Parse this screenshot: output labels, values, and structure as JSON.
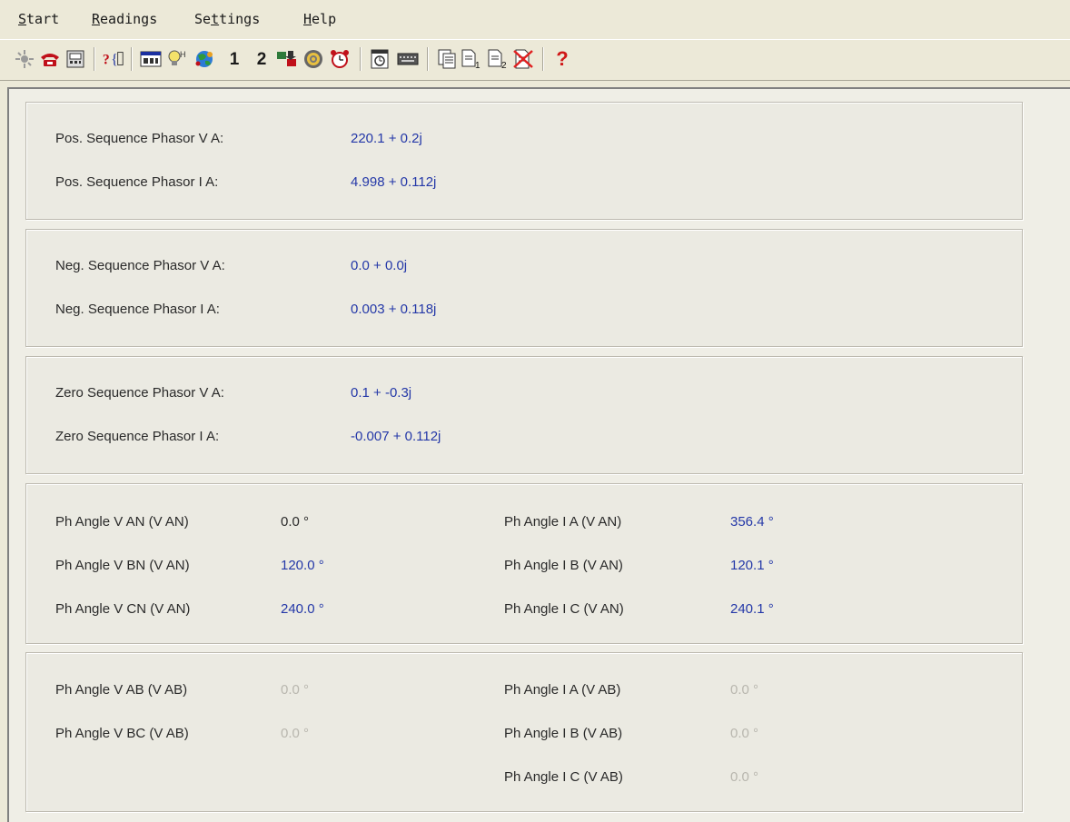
{
  "menu": {
    "start": {
      "first": "S",
      "rest": "tart"
    },
    "readings": {
      "first": "R",
      "rest": "eadings"
    },
    "settings": {
      "pre": "Se",
      "u": "t",
      "post": "tings"
    },
    "help": {
      "first": "H",
      "rest": "elp"
    }
  },
  "toolbar": {
    "icons": [
      "connect-icon",
      "phone-icon",
      "device-icon",
      "query-icon",
      "display-icon",
      "lightbulb-icon",
      "globe-icon",
      "number-1-icon",
      "number-2-icon",
      "transfer-icon",
      "target-icon",
      "alarm-icon",
      "timer-icon",
      "keyboard-icon",
      "copy-icon",
      "doc1-icon",
      "doc2-icon",
      "delete-icon",
      "help-icon"
    ],
    "label_1": "1",
    "label_2": "2",
    "label_help": "?"
  },
  "pos_sequence": {
    "v_label": "Pos. Sequence Phasor V A:",
    "v_value": "220.1 + 0.2j",
    "i_label": "Pos. Sequence Phasor I A:",
    "i_value": "4.998 + 0.112j"
  },
  "neg_sequence": {
    "v_label": "Neg. Sequence Phasor V A:",
    "v_value": "0.0 + 0.0j",
    "i_label": "Neg. Sequence Phasor I A:",
    "i_value": "0.003 + 0.118j"
  },
  "zero_sequence": {
    "v_label": "Zero Sequence Phasor V A:",
    "v_value": "0.1 + -0.3j",
    "i_label": "Zero Sequence Phasor I A:",
    "i_value": "-0.007 + 0.112j"
  },
  "angles_van": {
    "rows": [
      {
        "v_label": "Ph Angle V AN (V AN)",
        "v_value": "0.0 °",
        "i_label": "Ph Angle I A (V AN)",
        "i_value": "356.4 °"
      },
      {
        "v_label": "Ph Angle V BN (V AN)",
        "v_value": "120.0 °",
        "i_label": "Ph Angle I B (V AN)",
        "i_value": "120.1 °"
      },
      {
        "v_label": "Ph Angle V CN (V AN)",
        "v_value": "240.0 °",
        "i_label": "Ph Angle I C (V AN)",
        "i_value": "240.1 °"
      }
    ]
  },
  "angles_vab": {
    "v_rows": [
      {
        "label": "Ph Angle V AB (V AB)",
        "value": "0.0 °"
      },
      {
        "label": "Ph Angle V BC (V AB)",
        "value": "0.0 °"
      }
    ],
    "i_rows": [
      {
        "label": "Ph Angle I A (V AB)",
        "value": "0.0 °"
      },
      {
        "label": "Ph Angle I B (V AB)",
        "value": "0.0 °"
      },
      {
        "label": "Ph Angle I C (V AB)",
        "value": "0.0 °"
      }
    ]
  },
  "colors": {
    "value_blue": "#2438a8",
    "disabled_gray": "#b8b6ae",
    "panel_bg": "#ebeae2",
    "window_bg": "#ece9d8"
  }
}
